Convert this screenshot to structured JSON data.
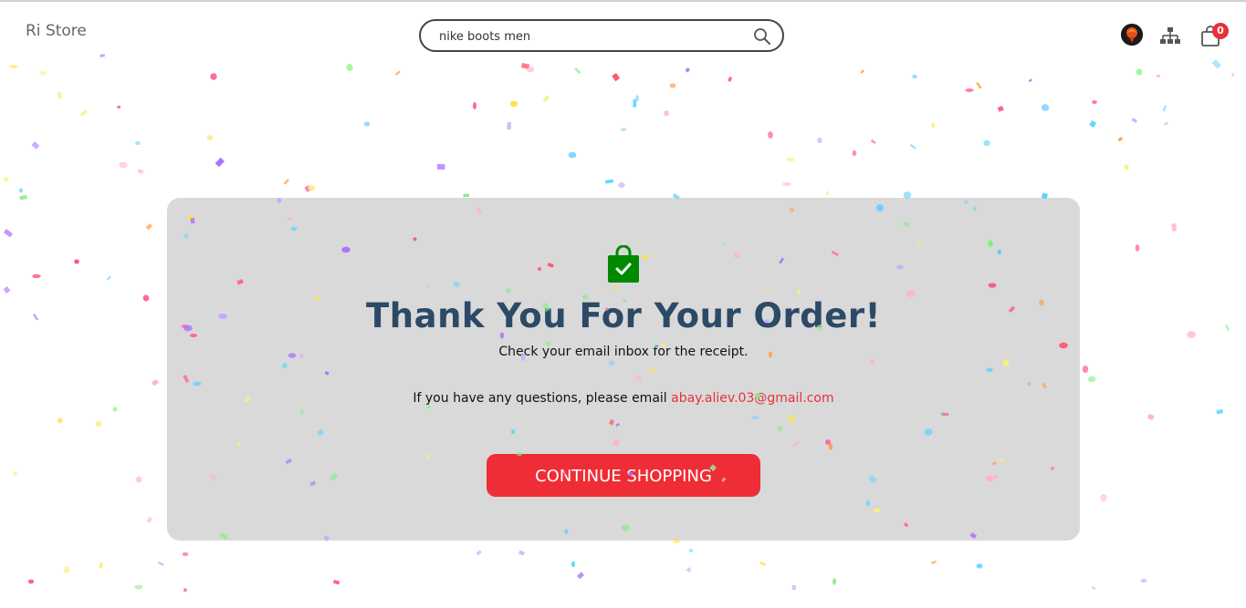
{
  "header": {
    "logo": "Ri Store",
    "search": {
      "value": "nike boots men",
      "placeholder": "Search"
    },
    "cart_count": "0"
  },
  "main": {
    "title": "Thank You For Your Order!",
    "subtitle": "Check your email inbox for the receipt.",
    "questions_text": "If you have any questions, please email",
    "email": "abay.aliev.03@gmail.com",
    "cta_label": "CONTINUE SHOPPING"
  },
  "icons": {
    "search": "search-icon",
    "avatar": "avatar",
    "sitemap": "sitemap-icon",
    "cart": "cart-icon",
    "success": "shopping-bag-check-icon"
  },
  "colors": {
    "accent": "#ef2d36",
    "title": "#2c4a66",
    "card": "#d9d9d9",
    "success": "#008a00"
  }
}
